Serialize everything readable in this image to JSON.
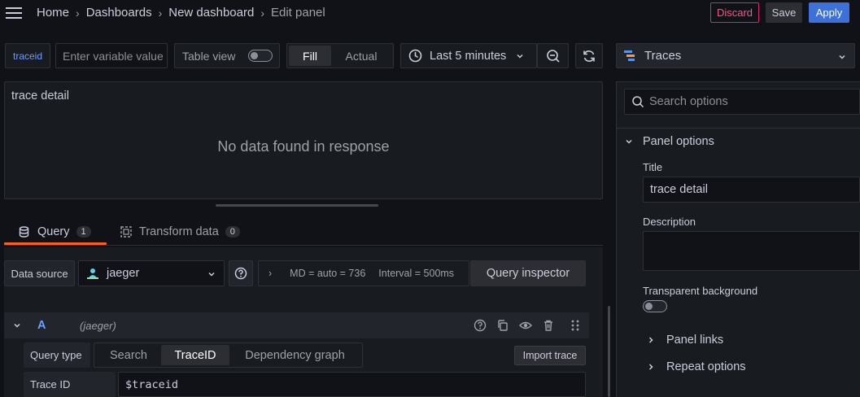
{
  "breadcrumb": {
    "items": [
      "Home",
      "Dashboards",
      "New dashboard",
      "Edit panel"
    ]
  },
  "actions": {
    "discard": "Discard",
    "save": "Save",
    "apply": "Apply"
  },
  "toolbar": {
    "variable_label": "traceid",
    "variable_placeholder": "Enter variable value",
    "table_view_label": "Table view",
    "table_view_on": false,
    "fill_label": "Fill",
    "actual_label": "Actual",
    "time_range": "Last 5 minutes"
  },
  "visualization": {
    "name": "Traces"
  },
  "panel": {
    "title": "trace detail",
    "empty_message": "No data found in response"
  },
  "tabs": [
    {
      "label": "Query",
      "count": "1"
    },
    {
      "label": "Transform data",
      "count": "0"
    }
  ],
  "query": {
    "data_source_label": "Data source",
    "data_source": "jaeger",
    "md": "MD = auto = 736",
    "interval": "Interval = 500ms",
    "inspector": "Query inspector",
    "row_letter": "A",
    "row_ds": "(jaeger)",
    "query_type_label": "Query type",
    "query_types": [
      "Search",
      "TraceID",
      "Dependency graph"
    ],
    "query_type_selected": "TraceID",
    "import_trace": "Import trace",
    "trace_id_label": "Trace ID",
    "trace_id_value": "$traceid"
  },
  "options": {
    "search_placeholder": "Search options",
    "panel_options": "Panel options",
    "title_label": "Title",
    "title_value": "trace detail",
    "description_label": "Description",
    "transparent_label": "Transparent background",
    "panel_links": "Panel links",
    "repeat_options": "Repeat options"
  },
  "colors": {
    "accent_blue": "#3d71d9",
    "discard_red": "#ff5286",
    "tab_underline": "#ff5f1f"
  }
}
